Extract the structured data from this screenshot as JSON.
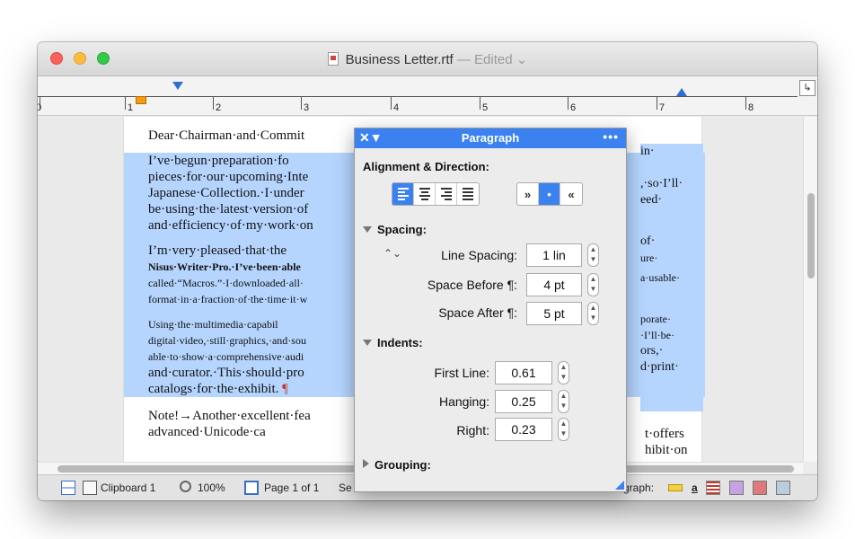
{
  "window": {
    "filename": "Business Letter.rtf",
    "status": " — Edited ⌄"
  },
  "ruler": {
    "numbers": [
      "0",
      "1",
      "2",
      "3",
      "4",
      "5",
      "6",
      "7",
      "8"
    ]
  },
  "document": {
    "line1": "Dear·Chairman·and·Commit",
    "p1": [
      "    I’ve·begun·preparation·fo",
      "pieces·for·our·upcoming·Inte",
      "Japanese·Collection.·I·under",
      "be·using·the·latest·version·of",
      "and·efficiency·of·my·work·on"
    ],
    "p1_right": [
      "in·",
      ",·so·I’ll·",
      "eed·",
      ""
    ],
    "p2": [
      "    I’m·very·pleased·that·the",
      "Nisus·Writer·Pro.·I’ve·been·able",
      "called·“Macros.”·I·downloaded·all·",
      "format·in·a·fraction·of·the·time·it·w"
    ],
    "p2_right": [
      "of·",
      "ure·",
      "a·usable·"
    ],
    "p3": [
      "    Using·the·multimedia·capabil",
      "digital·video,·still·graphics,·and·sou",
      "able·to·show·a·comprehensive·audi",
      "and·curator.·This·should·pro",
      "catalogs·for·the·exhibit."
    ],
    "p3_right": [
      "porate·",
      "·I’ll·be·",
      "ors,·",
      "d·print·"
    ],
    "pilcrow": "¶",
    "note": [
      "Note!→Another·excellent·fea",
      "        advanced·Unicode·ca"
    ],
    "note_right": [
      "t·offers",
      "hibit·on"
    ]
  },
  "statusbar": {
    "clipboard": "Clipboard 1",
    "zoom": "100%",
    "page": "Page 1 of 1",
    "se": "Se",
    "paragraph": "graph:"
  },
  "palette": {
    "close": "✕▼",
    "title": "Paragraph",
    "more": "•••",
    "align_section": "Alignment & Direction:",
    "dir_buttons": [
      "»",
      "•",
      "«"
    ],
    "spacing_section": "Spacing:",
    "line_spacing_label": "Line Spacing:",
    "line_spacing_value": "1 lin",
    "space_before_label": "Space Before ¶:",
    "space_before_value": "4 pt",
    "space_after_label": "Space After ¶:",
    "space_after_value": "5 pt",
    "indents_section": "Indents:",
    "first_line_label": "First Line:",
    "first_line_value": "0.61",
    "hanging_label": "Hanging:",
    "hanging_value": "0.25",
    "right_label": "Right:",
    "right_value": "0.23",
    "grouping_section": "Grouping:"
  },
  "colors": {
    "accent": "#3b82f0",
    "selection": "#b5d5ff"
  }
}
